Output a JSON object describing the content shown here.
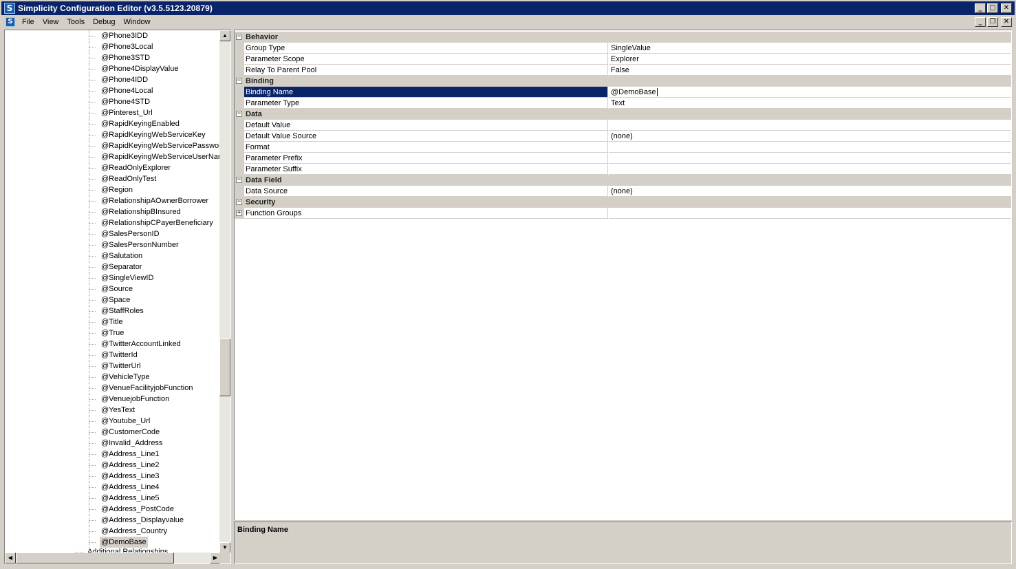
{
  "window": {
    "title": "Simplicity Configuration Editor (v3.5.5123.20879)",
    "app_icon_letter": "S",
    "buttons": {
      "minimize": "_",
      "maximize": "□",
      "close": "✕"
    }
  },
  "menubar": {
    "items": [
      "File",
      "View",
      "Tools",
      "Debug",
      "Window"
    ],
    "mdi_buttons": {
      "minimize": "_",
      "restore": "❐",
      "close": "✕"
    }
  },
  "tree": {
    "items": [
      "@Phone3IDD",
      "@Phone3Local",
      "@Phone3STD",
      "@Phone4DisplayValue",
      "@Phone4IDD",
      "@Phone4Local",
      "@Phone4STD",
      "@Pinterest_Url",
      "@RapidKeyingEnabled",
      "@RapidKeyingWebServiceKey",
      "@RapidKeyingWebServicePassword",
      "@RapidKeyingWebServiceUserNam",
      "@ReadOnlyExplorer",
      "@ReadOnlyTest",
      "@Region",
      "@RelationshipAOwnerBorrower",
      "@RelationshipBInsured",
      "@RelationshipCPayerBeneficiary",
      "@SalesPersonID",
      "@SalesPersonNumber",
      "@Salutation",
      "@Separator",
      "@SingleViewID",
      "@Source",
      "@Space",
      "@StaffRoles",
      "@Title",
      "@True",
      "@TwitterAccountLinked",
      "@TwitterId",
      "@TwitterUrl",
      "@VehicleType",
      "@VenueFacilityjobFunction",
      "@VenuejobFunction",
      "@YesText",
      "@Youtube_Url",
      "@CustomerCode",
      "@Invalid_Address",
      "@Address_Line1",
      "@Address_Line2",
      "@Address_Line3",
      "@Address_Line4",
      "@Address_Line5",
      "@Address_PostCode",
      "@Address_Displayvalue",
      "@Address_Country",
      "@DemoBase"
    ],
    "selected_item": "@DemoBase",
    "partial_item": "Additional Relationships",
    "scroll": {
      "up": "▲",
      "down": "▼",
      "left": "◀",
      "right": "▶"
    }
  },
  "property_grid": {
    "rows": [
      {
        "kind": "category",
        "label": "Behavior",
        "expander": "−"
      },
      {
        "kind": "property",
        "name": "Group Type",
        "value": "SingleValue"
      },
      {
        "kind": "property",
        "name": "Parameter Scope",
        "value": "Explorer"
      },
      {
        "kind": "property",
        "name": "Relay To Parent Pool",
        "value": "False"
      },
      {
        "kind": "category",
        "label": "Binding",
        "expander": "−"
      },
      {
        "kind": "property",
        "name": "Binding Name",
        "value": "@DemoBase",
        "selected": true
      },
      {
        "kind": "property",
        "name": "Parameter Type",
        "value": "Text"
      },
      {
        "kind": "category",
        "label": "Data",
        "expander": "−"
      },
      {
        "kind": "property",
        "name": "Default Value",
        "value": ""
      },
      {
        "kind": "property",
        "name": "Default Value Source",
        "value": "(none)"
      },
      {
        "kind": "property",
        "name": "Format",
        "value": ""
      },
      {
        "kind": "property",
        "name": "Parameter Prefix",
        "value": ""
      },
      {
        "kind": "property",
        "name": "Parameter Suffix",
        "value": ""
      },
      {
        "kind": "category",
        "label": "Data Field",
        "expander": "−"
      },
      {
        "kind": "property",
        "name": "Data Source",
        "value": "(none)"
      },
      {
        "kind": "category",
        "label": "Security",
        "expander": "−"
      },
      {
        "kind": "property",
        "name": "Function Groups",
        "value": "",
        "expander": "+"
      }
    ]
  },
  "description": {
    "title": "Binding Name",
    "text": ""
  },
  "colors": {
    "titlebar": "#0a246a",
    "selection": "#0a246a",
    "face": "#d4d0c8"
  }
}
